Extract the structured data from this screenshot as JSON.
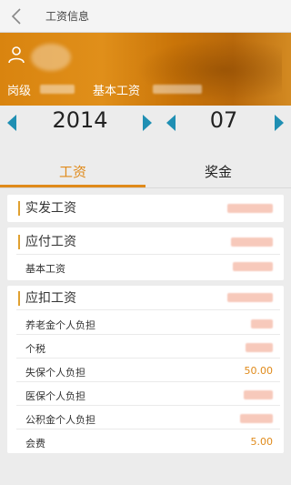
{
  "header": {
    "title": "工资信息"
  },
  "banner": {
    "position_label": "岗级",
    "base_salary_label": "基本工资"
  },
  "selector": {
    "year": "2014",
    "month": "07"
  },
  "tabs": [
    {
      "label": "工资"
    },
    {
      "label": "奖金"
    }
  ],
  "sections": {
    "actual": {
      "title": "实发工资"
    },
    "payable": {
      "title": "应付工资",
      "items": [
        {
          "label": "基本工资"
        }
      ]
    },
    "deduct": {
      "title": "应扣工资",
      "items": [
        {
          "label": "养老金个人负担",
          "value": ""
        },
        {
          "label": "个税",
          "value": ""
        },
        {
          "label": "失保个人负担",
          "value": "50.00"
        },
        {
          "label": "医保个人负担",
          "value": ""
        },
        {
          "label": "公积金个人负担",
          "value": ""
        },
        {
          "label": "会费",
          "value": "5.00"
        }
      ]
    }
  },
  "colors": {
    "accent": "#e08a1a",
    "arrow": "#1f8fb3",
    "banner": "#d9840f"
  }
}
